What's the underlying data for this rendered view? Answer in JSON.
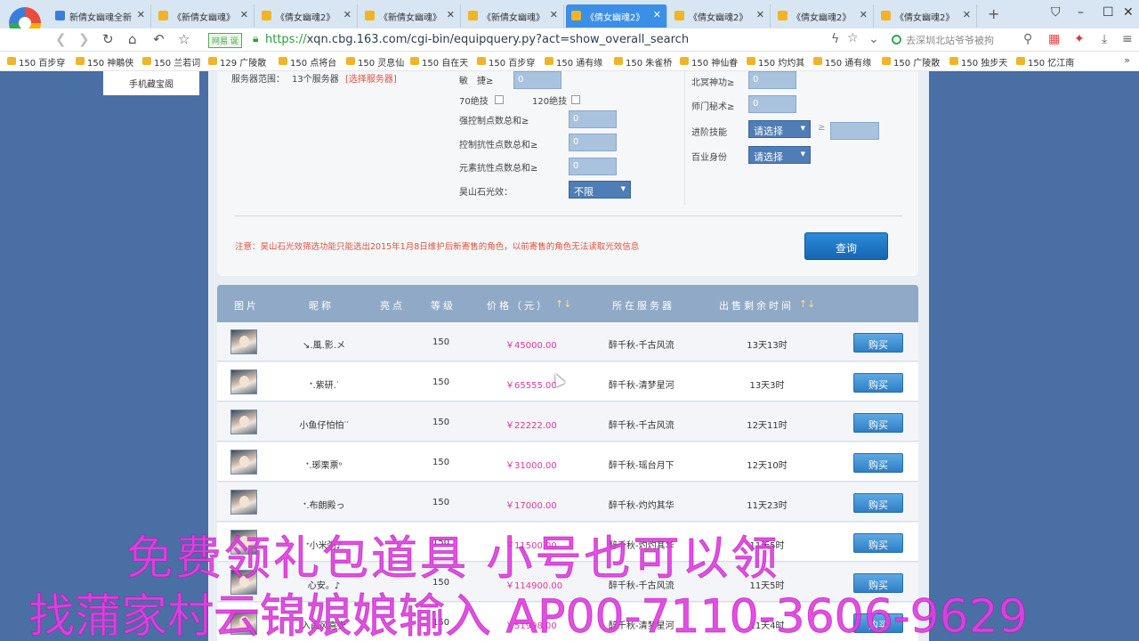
{
  "tabs": [
    {
      "label": "新倩女幽魂全新",
      "icon": "window-icon",
      "active": false
    },
    {
      "label": "《新倩女幽魂》",
      "icon": "game-icon",
      "active": false
    },
    {
      "label": "《倩女幽魂2》",
      "icon": "game-icon",
      "active": false
    },
    {
      "label": "《新倩女幽魂》",
      "icon": "game-icon",
      "active": false
    },
    {
      "label": "《新倩女幽魂》",
      "icon": "game-icon",
      "active": false
    },
    {
      "label": "《倩女幽魂2》",
      "icon": "game-icon",
      "active": true
    },
    {
      "label": "《倩女幽魂2》",
      "icon": "game-icon",
      "active": false
    },
    {
      "label": "《倩女幽魂2》",
      "icon": "game-icon",
      "active": false
    },
    {
      "label": "《倩女幽魂2》",
      "icon": "game-icon",
      "active": false
    }
  ],
  "browser": {
    "site_badge": "网易 诞",
    "url_scheme": "https://",
    "url_rest": "xqn.cbg.163.com/cgi-bin/equipquery.py?act=show_overall_search",
    "search_placeholder": "去深圳北站爷爷被拘"
  },
  "bookmarks": [
    "150 百步穿",
    "150 神鵰侠",
    "150 兰若词",
    "129 广陵散",
    "150 点将台",
    "150 灵息仙",
    "150 自在天",
    "150 百步穿",
    "150 通有缘",
    "150 朱雀桥",
    "150 神仙眷",
    "150 灼灼其",
    "150 通有缘",
    "150 广陵散",
    "150 独步天",
    "150 忆江南"
  ],
  "side_menu": {
    "label": "手机藏宝阁"
  },
  "filters": {
    "server_range_label": "服务器范围：",
    "server_range_value": "13个服务器",
    "server_range_link": "[选择服务器]",
    "agility_label": "敏　捷≥",
    "agility_value": "0",
    "skill70_label": "70绝技",
    "skill120_label": "120绝技",
    "ctrl_total_label": "强控制点数总和≥",
    "ctrl_total_value": "0",
    "ctrl_resist_label": "控制抗性点数总和≥",
    "ctrl_resist_value": "0",
    "elem_resist_label": "元素抗性点数总和≥",
    "elem_resist_value": "0",
    "haotian_label": "昊山石光效：",
    "haotian_value": "不限",
    "beiming_label": "北冥神功≥",
    "beiming_value": "0",
    "school_secret_label": "师门秘术≥",
    "school_secret_value": "0",
    "adv_skill_label": "进阶技能",
    "adv_skill_value": "请选择",
    "gt_symbol": "≥",
    "profession_label": "百业身份",
    "profession_value": "请选择",
    "note": "注意：昊山石光效筛选功能只能选出2015年1月8日维护后新寄售的角色，以前寄售的角色无法读取光效信息",
    "search_button": "查询"
  },
  "table": {
    "headers": {
      "image": "图片",
      "nickname": "昵称",
      "highlight": "亮点",
      "level": "等级",
      "price": "价格（元）",
      "price_sort": "↑↓",
      "server": "所在服务器",
      "remaining": "出售剩余时间",
      "remaining_sort": "↑↓"
    },
    "buy_label": "购买",
    "rows": [
      {
        "nickname": "↘.風.影.メ",
        "level": "150",
        "price": "￥45000.00",
        "server": "醉千秋-千古风流",
        "remaining": "13天13时"
      },
      {
        "nickname": "ᐩ.紫研.ᐝ",
        "level": "150",
        "price": "￥65555.00",
        "server": "醉千秋-清梦星河",
        "remaining": "13天3时"
      },
      {
        "nickname": "小鱼仔怕怕ᐝᐝ",
        "level": "150",
        "price": "￥22222.00",
        "server": "醉千秋-千古风流",
        "remaining": "12天11时"
      },
      {
        "nickname": "ᐩ.琊栗票ᵒ",
        "level": "150",
        "price": "￥31000.00",
        "server": "醉千秋-瑶台月下",
        "remaining": "12天10时"
      },
      {
        "nickname": "ᐩ.布朗殿っ",
        "level": "150",
        "price": "￥17000.00",
        "server": "醉千秋-灼灼其华",
        "remaining": "11天23时"
      },
      {
        "nickname": "ᐩ小米粥♪",
        "level": "150",
        "price": "￥11500.00",
        "server": "醉千秋-灼灼其华",
        "remaining": "11天5时"
      },
      {
        "nickname": "心安。♪",
        "level": "150",
        "price": "￥114900.00",
        "server": "醉千秋-千古风流",
        "remaining": "11天5时"
      },
      {
        "nickname": "入画风喜安",
        "level": "150",
        "price": "￥51998.00",
        "server": "醉千秋-清梦星河",
        "remaining": "11天4时"
      }
    ]
  },
  "overlay": {
    "line1": "免费领礼包道具 小号也可以领",
    "line2": "找蒲家村云锦娘娘输入 AP00-7110-3606-9629"
  },
  "colors": {
    "accent": "#3c8fe6",
    "price": "#e0379c",
    "page_bg": "#4a6fa5",
    "overlay": "#e040e0"
  }
}
